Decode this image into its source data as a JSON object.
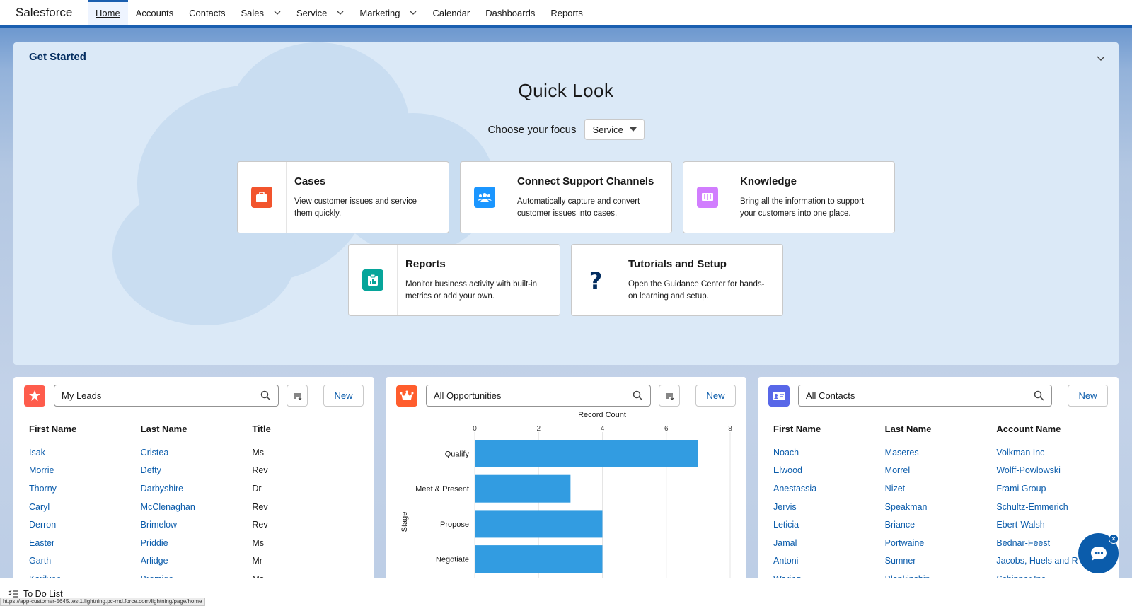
{
  "nav": {
    "app_name": "Salesforce",
    "items": [
      {
        "label": "Home",
        "active": true,
        "dropdown": false
      },
      {
        "label": "Accounts",
        "dropdown": false
      },
      {
        "label": "Contacts",
        "dropdown": false
      },
      {
        "label": "Sales",
        "dropdown": true
      },
      {
        "label": "Service",
        "dropdown": true
      },
      {
        "label": "Marketing",
        "dropdown": true
      },
      {
        "label": "Calendar",
        "dropdown": false
      },
      {
        "label": "Dashboards",
        "dropdown": false
      },
      {
        "label": "Reports",
        "dropdown": false
      }
    ]
  },
  "get_started": {
    "title": "Get Started",
    "heading": "Quick Look",
    "focus_label": "Choose your focus",
    "focus_value": "Service",
    "cards": [
      {
        "title": "Cases",
        "desc1": "View customer issues and service",
        "desc2": "them quickly.",
        "icon": "briefcase-icon",
        "color": "#f2542d"
      },
      {
        "title": "Connect Support Channels",
        "desc1": "Automatically capture and convert",
        "desc2": "customer issues into cases.",
        "icon": "people-icon",
        "color": "#1b96ff"
      },
      {
        "title": "Knowledge",
        "desc1": "Bring all the information to support",
        "desc2": "your customers into one place.",
        "icon": "book-icon",
        "color": "#d17dfe"
      },
      {
        "title": "Reports",
        "desc1": "Monitor business activity with built-in",
        "desc2": "metrics or add your own.",
        "icon": "report-icon",
        "color": "#06a59a"
      },
      {
        "title": "Tutorials and Setup",
        "desc1": "Open the Guidance Center for hands-",
        "desc2": "on learning and setup.",
        "icon": "question-icon",
        "color": "#032d60"
      }
    ]
  },
  "leads": {
    "list_name": "My Leads",
    "new_label": "New",
    "icon_color": "#fe5c4c",
    "columns": [
      "First Name",
      "Last Name",
      "Title"
    ],
    "rows": [
      [
        "Isak",
        "Cristea",
        "Ms"
      ],
      [
        "Morrie",
        "Defty",
        "Rev"
      ],
      [
        "Thorny",
        "Darbyshire",
        "Dr"
      ],
      [
        "Caryl",
        "McClenaghan",
        "Rev"
      ],
      [
        "Derron",
        "Brimelow",
        "Rev"
      ],
      [
        "Easter",
        "Priddie",
        "Ms"
      ],
      [
        "Garth",
        "Arlidge",
        "Mr"
      ],
      [
        "Karilynn",
        "Bromige",
        "Ms"
      ]
    ]
  },
  "opportunities": {
    "list_name": "All Opportunities",
    "new_label": "New",
    "icon_color": "#ff5d2d",
    "chart_data": {
      "type": "bar",
      "orientation": "horizontal",
      "title": "Record Count",
      "ylabel": "Stage",
      "categories": [
        "Qualify",
        "Meet & Present",
        "Propose",
        "Negotiate"
      ],
      "values": [
        7,
        3,
        4,
        4
      ],
      "xlim": [
        0,
        8
      ],
      "xticks": [
        "0",
        "2",
        "4",
        "6",
        "8"
      ],
      "grid": true,
      "bar_color": "#329ce1"
    }
  },
  "contacts": {
    "list_name": "All Contacts",
    "new_label": "New",
    "icon_color": "#5867e8",
    "columns": [
      "First Name",
      "Last Name",
      "Account Name"
    ],
    "rows": [
      [
        "Noach",
        "Maseres",
        "Volkman Inc"
      ],
      [
        "Elwood",
        "Morrel",
        "Wolff-Powlowski"
      ],
      [
        "Anestassia",
        "Nizet",
        "Frami Group"
      ],
      [
        "Jervis",
        "Speakman",
        "Schultz-Emmerich"
      ],
      [
        "Leticia",
        "Briance",
        "Ebert-Walsh"
      ],
      [
        "Jamal",
        "Portwaine",
        "Bednar-Feest"
      ],
      [
        "Antoni",
        "Sumner",
        "Jacobs, Huels and R"
      ],
      [
        "Waring",
        "Blenkinship",
        "Schinner Inc"
      ]
    ]
  },
  "utility": {
    "todo_label": "To Do List",
    "url": "https://app-customer-5645.test1.lightning.pc-rnd.force.com/lightning/page/home"
  }
}
